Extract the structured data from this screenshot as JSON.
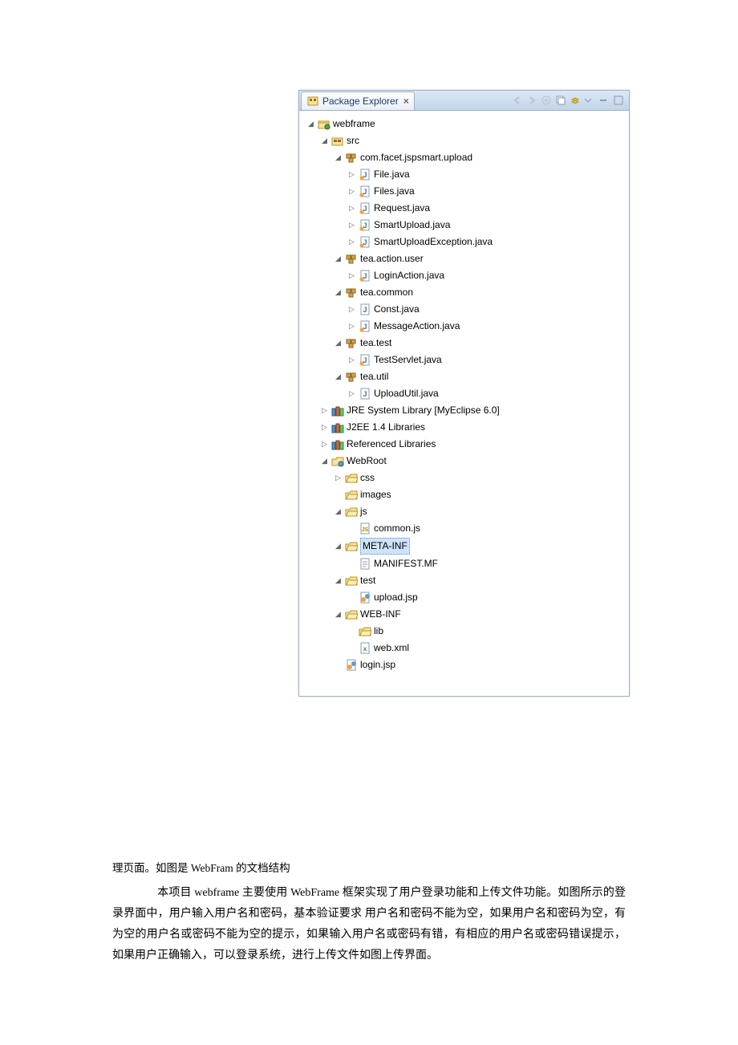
{
  "panel": {
    "tab_title": "Package Explorer"
  },
  "tree": {
    "project": "webframe",
    "src": "src",
    "pkg_upload": "com.facet.jspsmart.upload",
    "file_java": "File.java",
    "files_java": "Files.java",
    "request_java": "Request.java",
    "smart_java": "SmartUpload.java",
    "smartex_java": "SmartUploadException.java",
    "pkg_user": "tea.action.user",
    "login_action": "LoginAction.java",
    "pkg_common": "tea.common",
    "const_java": "Const.java",
    "msg_action": "MessageAction.java",
    "pkg_test": "tea.test",
    "test_servlet": "TestServlet.java",
    "pkg_util": "tea.util",
    "upload_util": "UploadUtil.java",
    "jre": "JRE System Library [MyEclipse 6.0]",
    "j2ee": "J2EE 1.4 Libraries",
    "ref_lib": "Referenced Libraries",
    "webroot": "WebRoot",
    "css": "css",
    "images": "images",
    "js": "js",
    "commonjs": "common.js",
    "metainf": "META-INF",
    "manifest": "MANIFEST.MF",
    "test": "test",
    "uploadjsp": "upload.jsp",
    "webinf": "WEB-INF",
    "lib": "lib",
    "webxml": "web.xml",
    "loginjsp": "login.jsp"
  },
  "doc": {
    "caption": "理页面。如图是 WebFram 的文档结构",
    "para": "　　本项目 webframe 主要使用 WebFrame 框架实现了用户登录功能和上传文件功能。如图所示的登录界面中，用户输入用户名和密码，基本验证要求 用户名和密码不能为空，如果用户名和密码为空，有为空的用户名或密码不能为空的提示，如果输入用户名或密码有错，有相应的用户名或密码错误提示，如果用户正确输入，可以登录系统，进行上传文件如图上传界面。"
  }
}
